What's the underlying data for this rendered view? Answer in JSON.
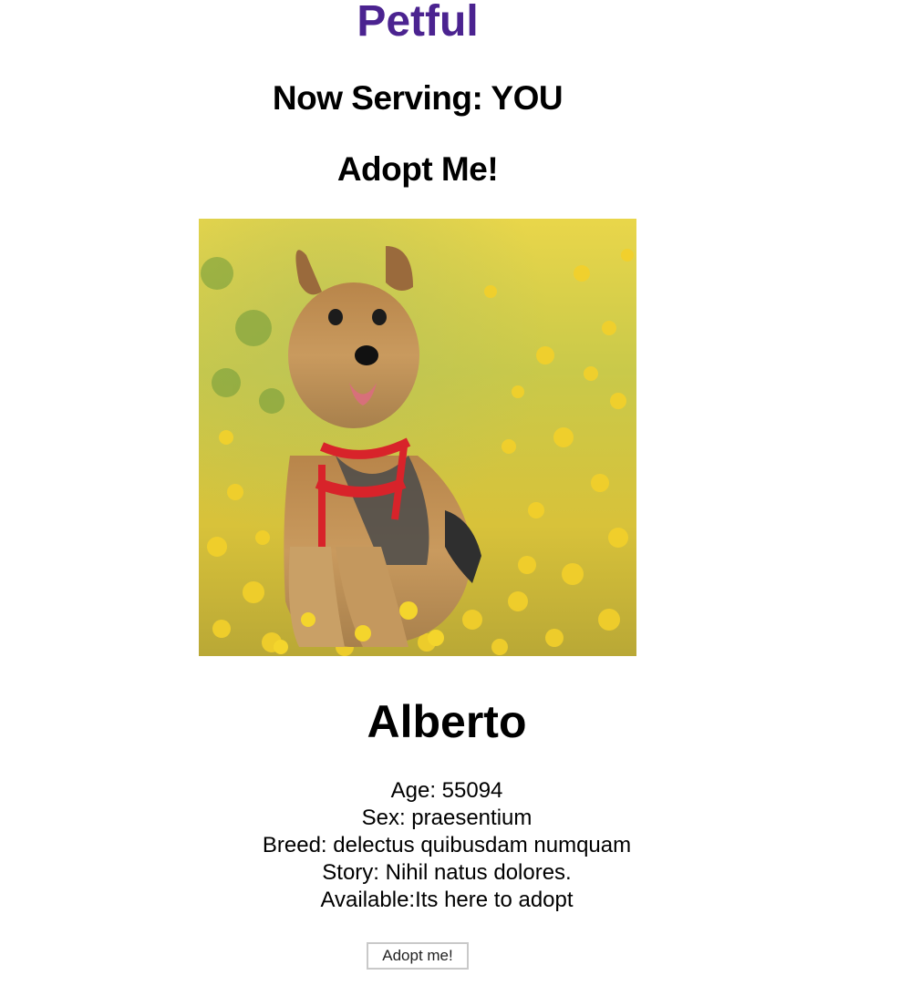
{
  "header": {
    "app_title": "Petful",
    "now_serving": "Now Serving: YOU",
    "section_title": "Adopt Me!"
  },
  "colors": {
    "brand": "#4b2390"
  },
  "pet": {
    "photo_subject": "yorkshire-terrier-in-flower-field",
    "name": "Alberto",
    "age": "Age: 55094",
    "sex": "Sex: praesentium",
    "breed": "Breed: delectus quibusdam numquam",
    "story": "Story: Nihil natus dolores.",
    "available": "Available:Its here to adopt"
  },
  "actions": {
    "adopt_label": "Adopt me!"
  }
}
